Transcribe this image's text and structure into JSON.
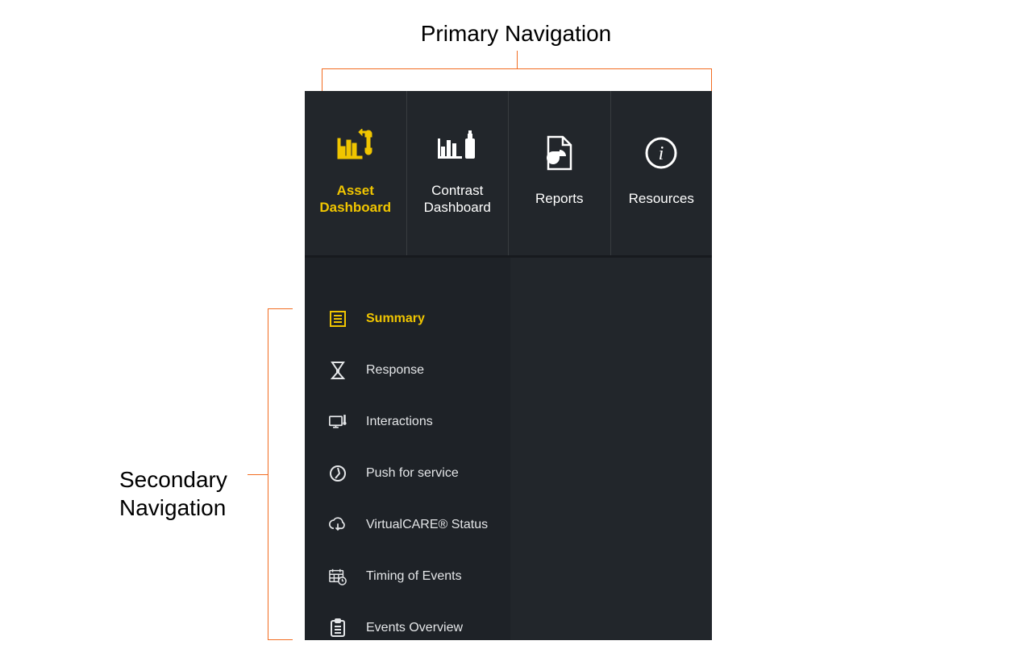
{
  "annotations": {
    "primary": "Primary Navigation",
    "secondary": "Secondary\nNavigation"
  },
  "colors": {
    "accent": "#F0C500",
    "bracket": "#F26C21",
    "panel": "#22262B"
  },
  "primary": {
    "items": [
      {
        "label": "Asset\nDashboard",
        "icon": "asset-dashboard-icon",
        "active": true
      },
      {
        "label": "Contrast\nDashboard",
        "icon": "contrast-dashboard-icon",
        "active": false
      },
      {
        "label": "Reports",
        "icon": "reports-icon",
        "active": false
      },
      {
        "label": "Resources",
        "icon": "resources-icon",
        "active": false
      }
    ]
  },
  "secondary": {
    "items": [
      {
        "label": "Summary",
        "icon": "summary-icon",
        "active": true
      },
      {
        "label": "Response",
        "icon": "response-icon",
        "active": false
      },
      {
        "label": "Interactions",
        "icon": "interactions-icon",
        "active": false
      },
      {
        "label": "Push for service",
        "icon": "push-icon",
        "active": false
      },
      {
        "label": "VirtualCARE® Status",
        "icon": "virtualcare-icon",
        "active": false
      },
      {
        "label": "Timing of Events",
        "icon": "timing-icon",
        "active": false
      },
      {
        "label": "Events Overview",
        "icon": "events-icon",
        "active": false
      }
    ]
  }
}
